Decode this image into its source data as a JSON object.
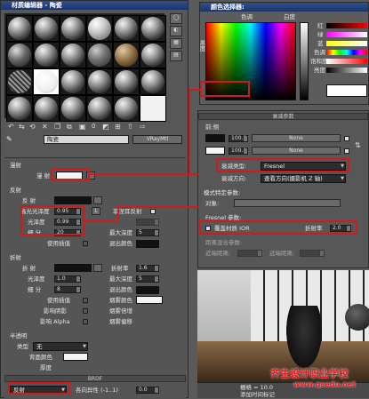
{
  "material_editor": {
    "title": "材质编辑器 - 陶瓷",
    "material_name": "陶瓷",
    "material_type": "VRayMtl",
    "sections": {
      "reflection_tab": "漫射",
      "diffuse_label": "漫 射",
      "reflect_section": "反射",
      "reflect_label": "反 射",
      "hilight_gloss_label": "高光光泽度",
      "hilight_gloss_value": "0.95",
      "hilight_L": "L",
      "fresnel_reflect_label": "菲涅耳反射",
      "refl_gloss_label": "光泽度",
      "refl_gloss_value": "0.99",
      "subdivs_label": "细 分",
      "subdivs_value": "20",
      "max_depth_label": "最大深度",
      "max_depth_value": "5",
      "use_interp_label": "使用插值",
      "exit_color_label": "退出颜色",
      "refract_section": "折射",
      "refract_label": "折 射",
      "refract_ior_label": "折射率",
      "refract_ior_value": "1.6",
      "refract_gloss_label": "光泽度",
      "refract_gloss_value": "1.0",
      "refract_max_depth_label": "最大深度",
      "refract_max_depth_value": "5",
      "refract_subdivs_label": "细 分",
      "refract_subdivs_value": "8",
      "refract_exit_label": "退出颜色",
      "refract_use_interp_label": "使用插值",
      "fog_color_label": "烟雾颜色",
      "affect_shadows_label": "影响阴影",
      "fog_mult_label": "烟雾倍增",
      "affect_alpha_label": "影响 Alpha",
      "fog_bias_label": "烟雾偏移",
      "translucent_section": "半透明",
      "type_label": "类型",
      "type_value": "无",
      "backside_color_label": "背面颜色",
      "thickness_label": "厚度",
      "brdf_label": "BRDF",
      "brdf_type": "反射",
      "anisotropy_label": "各向异性 (-1..1)",
      "anisotropy_value": "0.0"
    }
  },
  "color_selector": {
    "title": "颜色选择器:",
    "hue_label": "色调",
    "whiteness_label": "白度",
    "blackness_label": "黑度",
    "channels": [
      "红",
      "绿",
      "蓝",
      "色调",
      "饱和度",
      "亮度"
    ]
  },
  "falloff": {
    "title": "衰减参数",
    "front_side_label": "前:侧",
    "value1": "100.0",
    "value2": "100.0",
    "map1": "None",
    "map2": "None",
    "falloff_type_label": "衰减类型:",
    "falloff_type_value": "Fresnel",
    "falloff_dir_label": "衰减方向:",
    "falloff_dir_value": "查看方向(摄影机 Z 轴)",
    "mode_section": "模式特定参数:",
    "object_label": "对象:",
    "fresnel_params_label": "Fresnel 参数:",
    "override_ior_label": "覆盖材质 IOR",
    "ior_label": "折射率",
    "ior_value": "2.0",
    "distance_blend_label": "距离混合参数:",
    "near_label": "近端距离:",
    "far_label": "远端距离:"
  },
  "status": {
    "grid_label": "栅格 = 10.0",
    "add_time_label": "添加时间标记"
  },
  "watermark": {
    "line1": "齐生设计职业学校",
    "line2": "www.qsedu.net"
  },
  "colors": {
    "highlight_red": "#d21a1a",
    "titlebar_blue": "#1c3568",
    "watermark_red": "#e8141a"
  }
}
